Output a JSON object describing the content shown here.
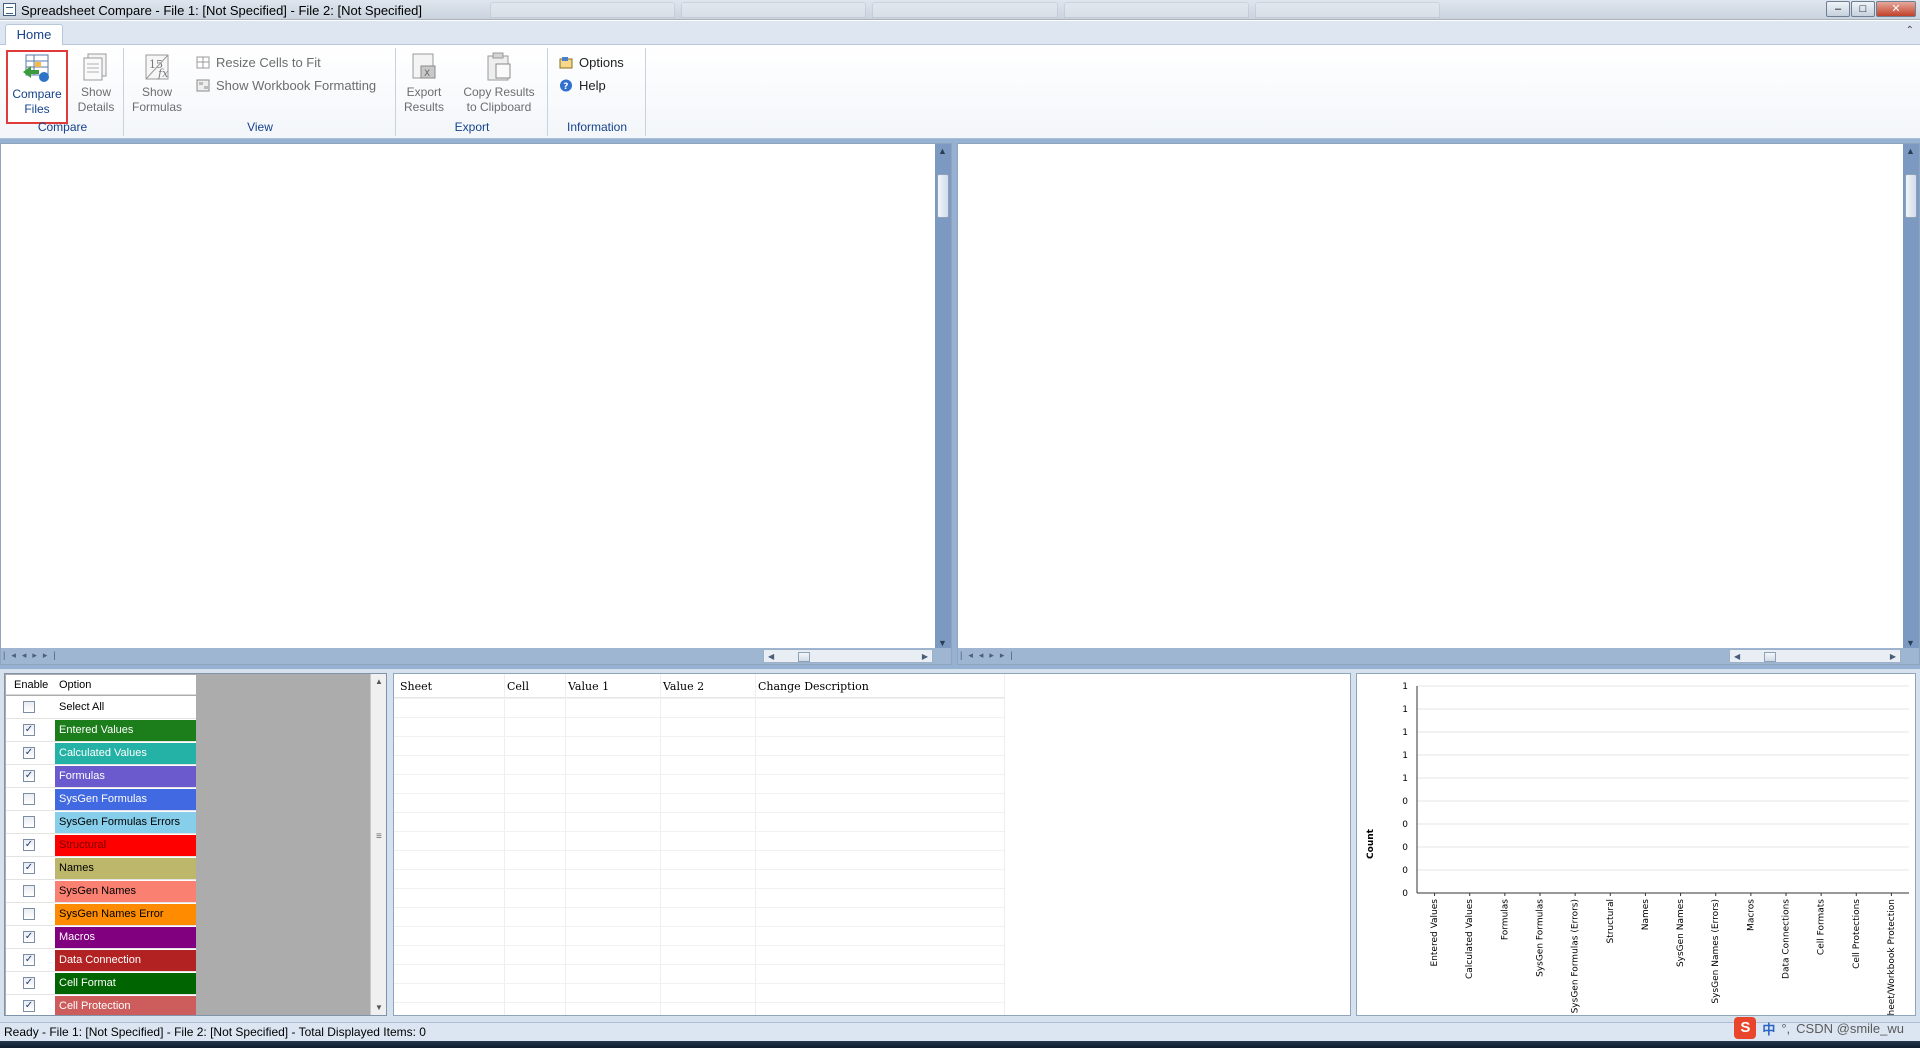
{
  "window": {
    "title": "Spreadsheet Compare - File 1: [Not Specified] - File 2: [Not Specified]",
    "controls": [
      "minimize",
      "maximize",
      "close"
    ]
  },
  "tabs": {
    "home_label": "Home"
  },
  "ribbon": {
    "compare": {
      "group_label": "Compare",
      "compare_files": "Compare\nFiles",
      "show_details": "Show\nDetails"
    },
    "view": {
      "group_label": "View",
      "show_formulas": "Show\nFormulas",
      "resize_cells": "Resize Cells to Fit",
      "show_formatting": "Show Workbook Formatting"
    },
    "export": {
      "group_label": "Export",
      "export_results": "Export\nResults",
      "copy_results": "Copy Results\nto Clipboard"
    },
    "information": {
      "group_label": "Information",
      "options": "Options",
      "help": "Help"
    }
  },
  "options_panel": {
    "header_enable": "Enable",
    "header_option": "Option",
    "items": [
      {
        "label": "Select All",
        "checked": false,
        "color": "#ffffff",
        "text_color": "#000000"
      },
      {
        "label": "Entered Values",
        "checked": true,
        "color": "#1b7e1b",
        "text_color": "#ffffff"
      },
      {
        "label": "Calculated Values",
        "checked": true,
        "color": "#23b2a5",
        "text_color": "#ffffff"
      },
      {
        "label": "Formulas",
        "checked": true,
        "color": "#6a5acd",
        "text_color": "#ffffff"
      },
      {
        "label": "SysGen Formulas",
        "checked": false,
        "color": "#4169e1",
        "text_color": "#ffffff"
      },
      {
        "label": "SysGen Formulas Errors",
        "checked": false,
        "color": "#87ceeb",
        "text_color": "#000000"
      },
      {
        "label": "Structural",
        "checked": true,
        "color": "#ff0000",
        "text_color": "#7a0000"
      },
      {
        "label": "Names",
        "checked": true,
        "color": "#bdb76b",
        "text_color": "#000000"
      },
      {
        "label": "SysGen Names",
        "checked": false,
        "color": "#fa8072",
        "text_color": "#000000"
      },
      {
        "label": "SysGen Names Error",
        "checked": false,
        "color": "#ff8c00",
        "text_color": "#000000"
      },
      {
        "label": "Macros",
        "checked": true,
        "color": "#800080",
        "text_color": "#ffffff"
      },
      {
        "label": "Data Connection",
        "checked": true,
        "color": "#b22222",
        "text_color": "#ffffff"
      },
      {
        "label": "Cell Format",
        "checked": true,
        "color": "#006400",
        "text_color": "#ffffff"
      },
      {
        "label": "Cell Protection",
        "checked": true,
        "color": "#cd5c5c",
        "text_color": "#ffffff"
      }
    ]
  },
  "results_table": {
    "columns": [
      "Sheet",
      "Cell",
      "Value 1",
      "Value 2",
      "Change Description"
    ],
    "rows": []
  },
  "chart_data": {
    "type": "bar",
    "ylabel": "Count",
    "xlabel": "",
    "ytick_labels": [
      "1",
      "1",
      "1",
      "1",
      "1",
      "0",
      "0",
      "0",
      "0",
      "0"
    ],
    "categories": [
      "Entered Values",
      "Calculated Values",
      "Formulas",
      "SysGen Formulas",
      "SysGen Formulas (Errors)",
      "Structural",
      "Names",
      "SysGen Names",
      "SysGen Names (Errors)",
      "Macros",
      "Data Connections",
      "Cell Formats",
      "Cell Protections",
      "Sheet/Workbook Protection"
    ],
    "values": [
      0,
      0,
      0,
      0,
      0,
      0,
      0,
      0,
      0,
      0,
      0,
      0,
      0,
      0
    ],
    "ylim": [
      0,
      1
    ],
    "grid": true
  },
  "statusbar": {
    "text": "Ready - File 1: [Not Specified] - File 2: [Not Specified] - Total Displayed Items: 0"
  },
  "tray": {
    "ime_logo": "S",
    "ime_mode": "中",
    "watermark": "CSDN @smile_wu"
  }
}
